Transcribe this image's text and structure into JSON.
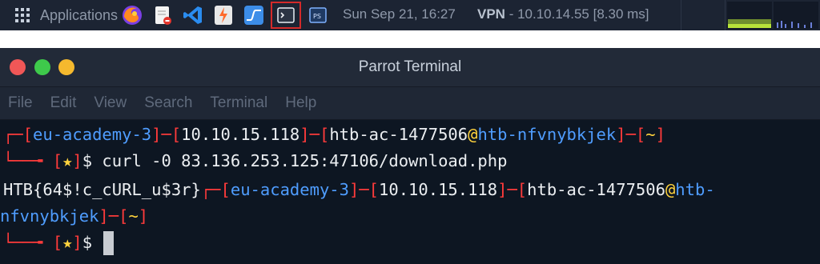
{
  "panel": {
    "apps_label": "Applications",
    "datetime": "Sun Sep 21, 16:27",
    "vpn_label": "VPN",
    "vpn_text": " - 10.10.14.55 [8.30 ms]",
    "launchers": [
      {
        "icon": "firefox-icon"
      },
      {
        "icon": "text-editor-icon"
      },
      {
        "icon": "vscode-icon"
      },
      {
        "icon": "burp-suite-icon"
      },
      {
        "icon": "system-monitor-icon"
      },
      {
        "icon": "terminal-icon"
      },
      {
        "icon": "powershell-icon"
      }
    ]
  },
  "window": {
    "title": "Parrot Terminal",
    "menu": [
      "File",
      "Edit",
      "View",
      "Search",
      "Terminal",
      "Help"
    ]
  },
  "terminal": {
    "host_tag": "eu-academy-3",
    "ip": "10.10.15.118",
    "user": "htb-ac-1477506",
    "at": "@",
    "machine": "htb-nfvnybkjek",
    "machine_part1": "htb-",
    "machine_part2": "nfvnybkjek",
    "cwd": "~",
    "prompt_star": "★",
    "prompt_dollar": "$",
    "command": " curl -0 83.136.253.125:47106/download.php",
    "output": "HTB{64$!c_cURL_u$3r}"
  },
  "colors": {
    "prompt_frame": "#ff3b3b",
    "prompt_blue": "#4f9dff",
    "prompt_star": "#ffd33d",
    "terminal_bg": "#0d1622",
    "panel_bg": "#1c2433",
    "highlight_outline": "#d42a2a"
  }
}
